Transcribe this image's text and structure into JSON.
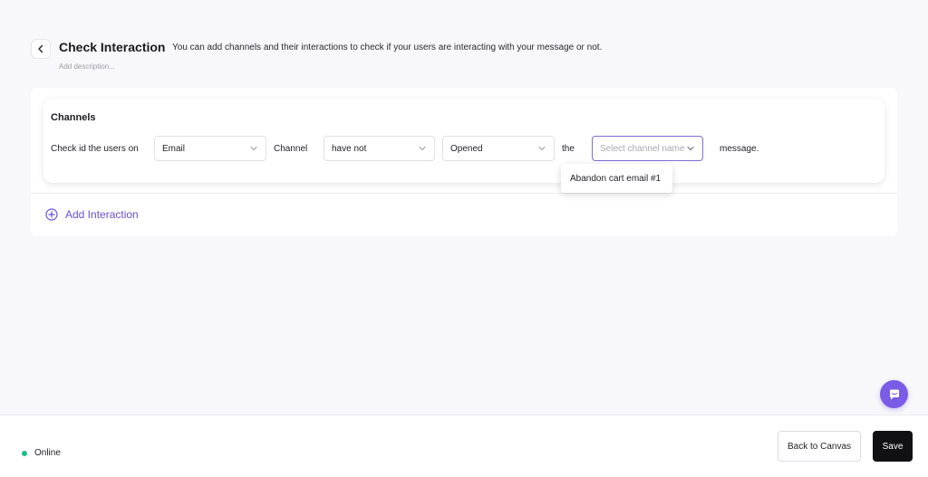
{
  "header": {
    "title": "Check Interaction",
    "subtitle": "You can add channels and their interactions to check if your users are interacting with your message or not.",
    "add_description": "Add description..."
  },
  "channels": {
    "title": "Channels",
    "prefix": "Check id the users on",
    "channel_select": "Email",
    "channel_word": "Channel",
    "condition_select": "have not",
    "interaction_select": "Opened",
    "the_word": "the",
    "channel_name_placeholder": "Select channel name",
    "suffix": "message.",
    "dropdown_options": [
      "Abandon cart email #1"
    ]
  },
  "add_interaction_label": "Add Interaction",
  "footer": {
    "status": "Online",
    "status_color": "#1bbf86",
    "back_label": "Back to Canvas",
    "save_label": "Save"
  },
  "colors": {
    "accent": "#6a4fd1",
    "chat_fab": "#7b5ce6"
  },
  "icons": {
    "back": "chevron-left-icon",
    "select_arrow": "chevron-down-icon",
    "add": "plus-circle-icon",
    "chat": "chat-bubble-icon"
  }
}
